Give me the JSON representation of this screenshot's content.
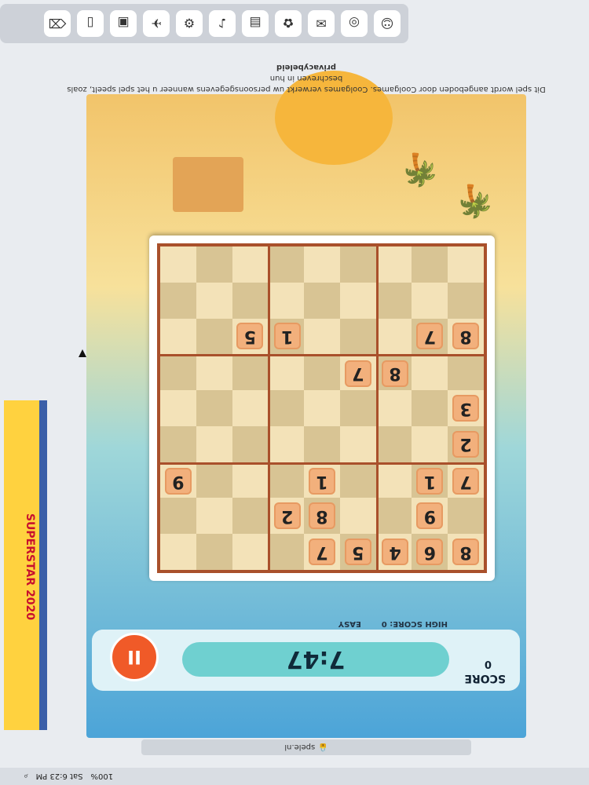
{
  "system": {
    "clock": "Sat 6:23 PM",
    "battery": "100%",
    "url": "spele.nl"
  },
  "ad": {
    "text": "SUPERSTAR 2020"
  },
  "game": {
    "score_label": "SCORE",
    "score_value": "0",
    "timer": "7:47",
    "pause_label": "II",
    "high_score": "HIGH SCORE: 0",
    "difficulty": "EASY",
    "colors": {
      "board_frame": "#a9502b",
      "tile": "#f2b07c",
      "timer_bg": "#6fd0d0",
      "pause_btn": "#f05a28"
    }
  },
  "board": {
    "rows": [
      [
        "8",
        "6",
        "4",
        "5",
        "7",
        "",
        "",
        "",
        ""
      ],
      [
        "",
        "9",
        "",
        "",
        "8",
        "2",
        "",
        "",
        ""
      ],
      [
        "7",
        "1",
        "",
        "",
        "1",
        "",
        "",
        "",
        "9"
      ],
      [
        "2",
        "",
        "",
        "",
        "",
        "",
        "",
        "",
        ""
      ],
      [
        "3",
        "",
        "",
        "",
        "",
        "",
        "",
        "",
        ""
      ],
      [
        "",
        "",
        "8",
        "7",
        "",
        "",
        "",
        "",
        ""
      ],
      [
        "8",
        "7",
        "",
        "",
        "",
        "1",
        "5",
        "",
        ""
      ],
      [
        "",
        "",
        "",
        "",
        "",
        "",
        "",
        "",
        ""
      ],
      [
        "",
        "",
        "",
        "",
        "",
        "",
        "",
        "",
        ""
      ]
    ]
  },
  "footer": {
    "line1": "Dit spel wordt aangeboden door Coolgames. Coolgames verwerkt uw persoonsgegevens wanneer u het spel speelt, zoals beschreven in hun",
    "link": "privacybeleid"
  }
}
